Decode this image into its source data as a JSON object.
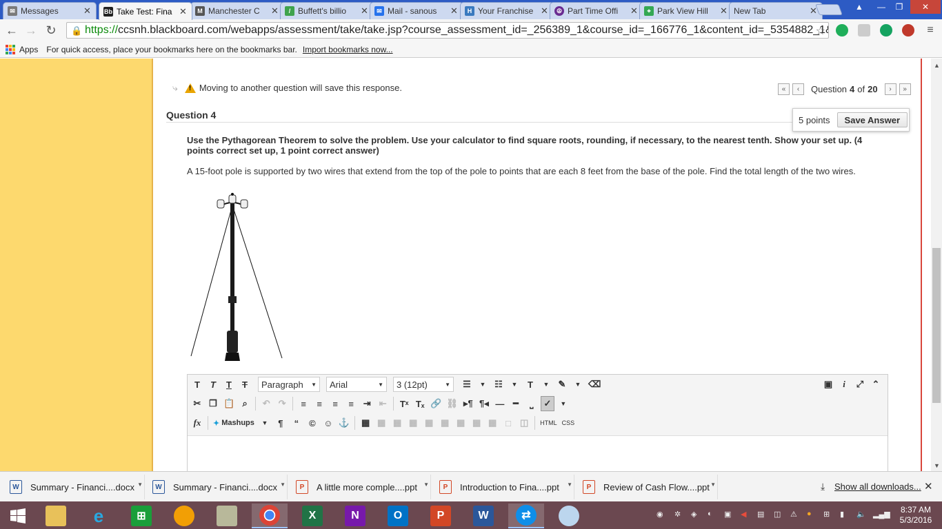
{
  "tabs": [
    {
      "label": "Messages",
      "icon": "messages-icon",
      "color": "#7a7a7a"
    },
    {
      "label": "Take Test: Fina",
      "icon": "blackboard-icon",
      "color": "#222222",
      "active": true
    },
    {
      "label": "Manchester C",
      "icon": "m-icon",
      "color": "#555555"
    },
    {
      "label": "Buffett's billio",
      "icon": "doc-icon",
      "color": "#3fa34d"
    },
    {
      "label": "Mail - sanous",
      "icon": "mail-icon",
      "color": "#2672ec"
    },
    {
      "label": "Your Franchise",
      "icon": "h-icon",
      "color": "#3a7abf"
    },
    {
      "label": "Part Time Offi",
      "icon": "peace-icon",
      "color": "#6a2c91"
    },
    {
      "label": "Park View Hill",
      "icon": "maps-icon",
      "color": "#34a853"
    },
    {
      "label": "New Tab",
      "icon": "",
      "color": ""
    }
  ],
  "address": {
    "scheme": "https://",
    "url": "ccsnh.blackboard.com/webapps/assessment/take/take.jsp?course_assessment_id=_256389_1&course_id=_166776_1&content_id=_5354882_1&"
  },
  "bookmarks": {
    "apps": "Apps",
    "hint": "For quick access, place your bookmarks here on the bookmarks bar.",
    "import": "Import bookmarks now..."
  },
  "test": {
    "warning": "Moving to another question will save this response.",
    "nav": {
      "prefix": "Question",
      "current": "4",
      "of": "of",
      "total": "20"
    },
    "question_title": "Question 4",
    "points": "5 points",
    "save_label": "Save Answer",
    "instructions": "Use the Pythagorean Theorem to solve the problem. Use your calculator to find square roots, rounding, if necessary, to the nearest tenth. Show your set up. (4 points correct set up, 1 point correct answer)",
    "problem": "A 15-foot pole is supported by two wires that extend from the top of the pole to points that are each 8 feet from the base of the pole. Find the total length of the two wires."
  },
  "editor": {
    "paragraph": "Paragraph",
    "font": "Arial",
    "size": "3 (12pt)",
    "mashups": "Mashups",
    "html": "HTML",
    "css": "CSS"
  },
  "downloads": {
    "items": [
      {
        "name": "Summary - Financi....docx",
        "type": "word"
      },
      {
        "name": "Summary - Financi....docx",
        "type": "word"
      },
      {
        "name": "A little more comple....ppt",
        "type": "ppt"
      },
      {
        "name": "Introduction to Fina....ppt",
        "type": "ppt"
      },
      {
        "name": "Review of Cash Flow....ppt",
        "type": "ppt"
      }
    ],
    "show_all": "Show all downloads..."
  },
  "clock": {
    "time": "8:37 AM",
    "date": "5/3/2016"
  },
  "colors": {
    "left_panel": "#fdd96e",
    "accent_red": "#d8453a",
    "taskbar": "#6b4850",
    "tab_strip": "#2d5bc4"
  }
}
